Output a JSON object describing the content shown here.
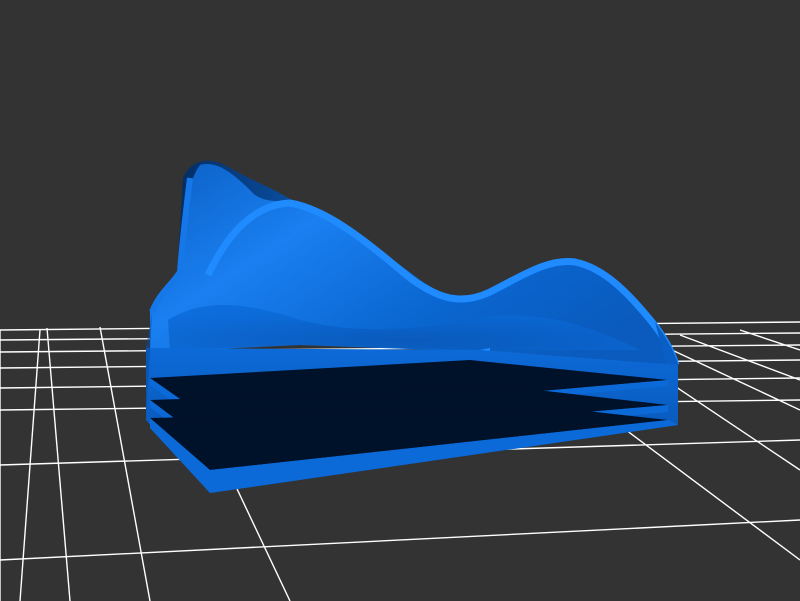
{
  "scene": {
    "background_color": "#333333",
    "grid_color": "#ffffff",
    "model": {
      "shape": "terrain-block",
      "surface_color": "#0a6cd6",
      "surface_highlight": "#1a86ff",
      "surface_shadow": "#063a7a",
      "slot_color": "#00112a",
      "stacked_layers": 3
    }
  }
}
